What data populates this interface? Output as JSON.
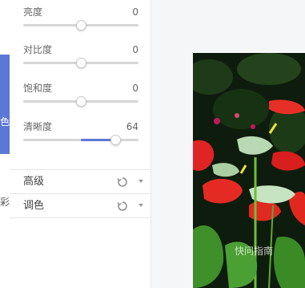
{
  "sidebar": {
    "active_label": "色",
    "label_lower": "彩"
  },
  "adjust": {
    "sliders": [
      {
        "label": "亮度",
        "value": "0",
        "fraction": 0.5
      },
      {
        "label": "对比度",
        "value": "0",
        "fraction": 0.5
      },
      {
        "label": "饱和度",
        "value": "0",
        "fraction": 0.5
      },
      {
        "label": "清晰度",
        "value": "64",
        "fraction": 0.8
      }
    ],
    "sections": [
      {
        "label": "高级"
      },
      {
        "label": "调色"
      }
    ]
  },
  "image": {
    "watermark": "快问指南"
  },
  "colors": {
    "accent": "#5b78d6",
    "track": "#d6d6d6"
  }
}
